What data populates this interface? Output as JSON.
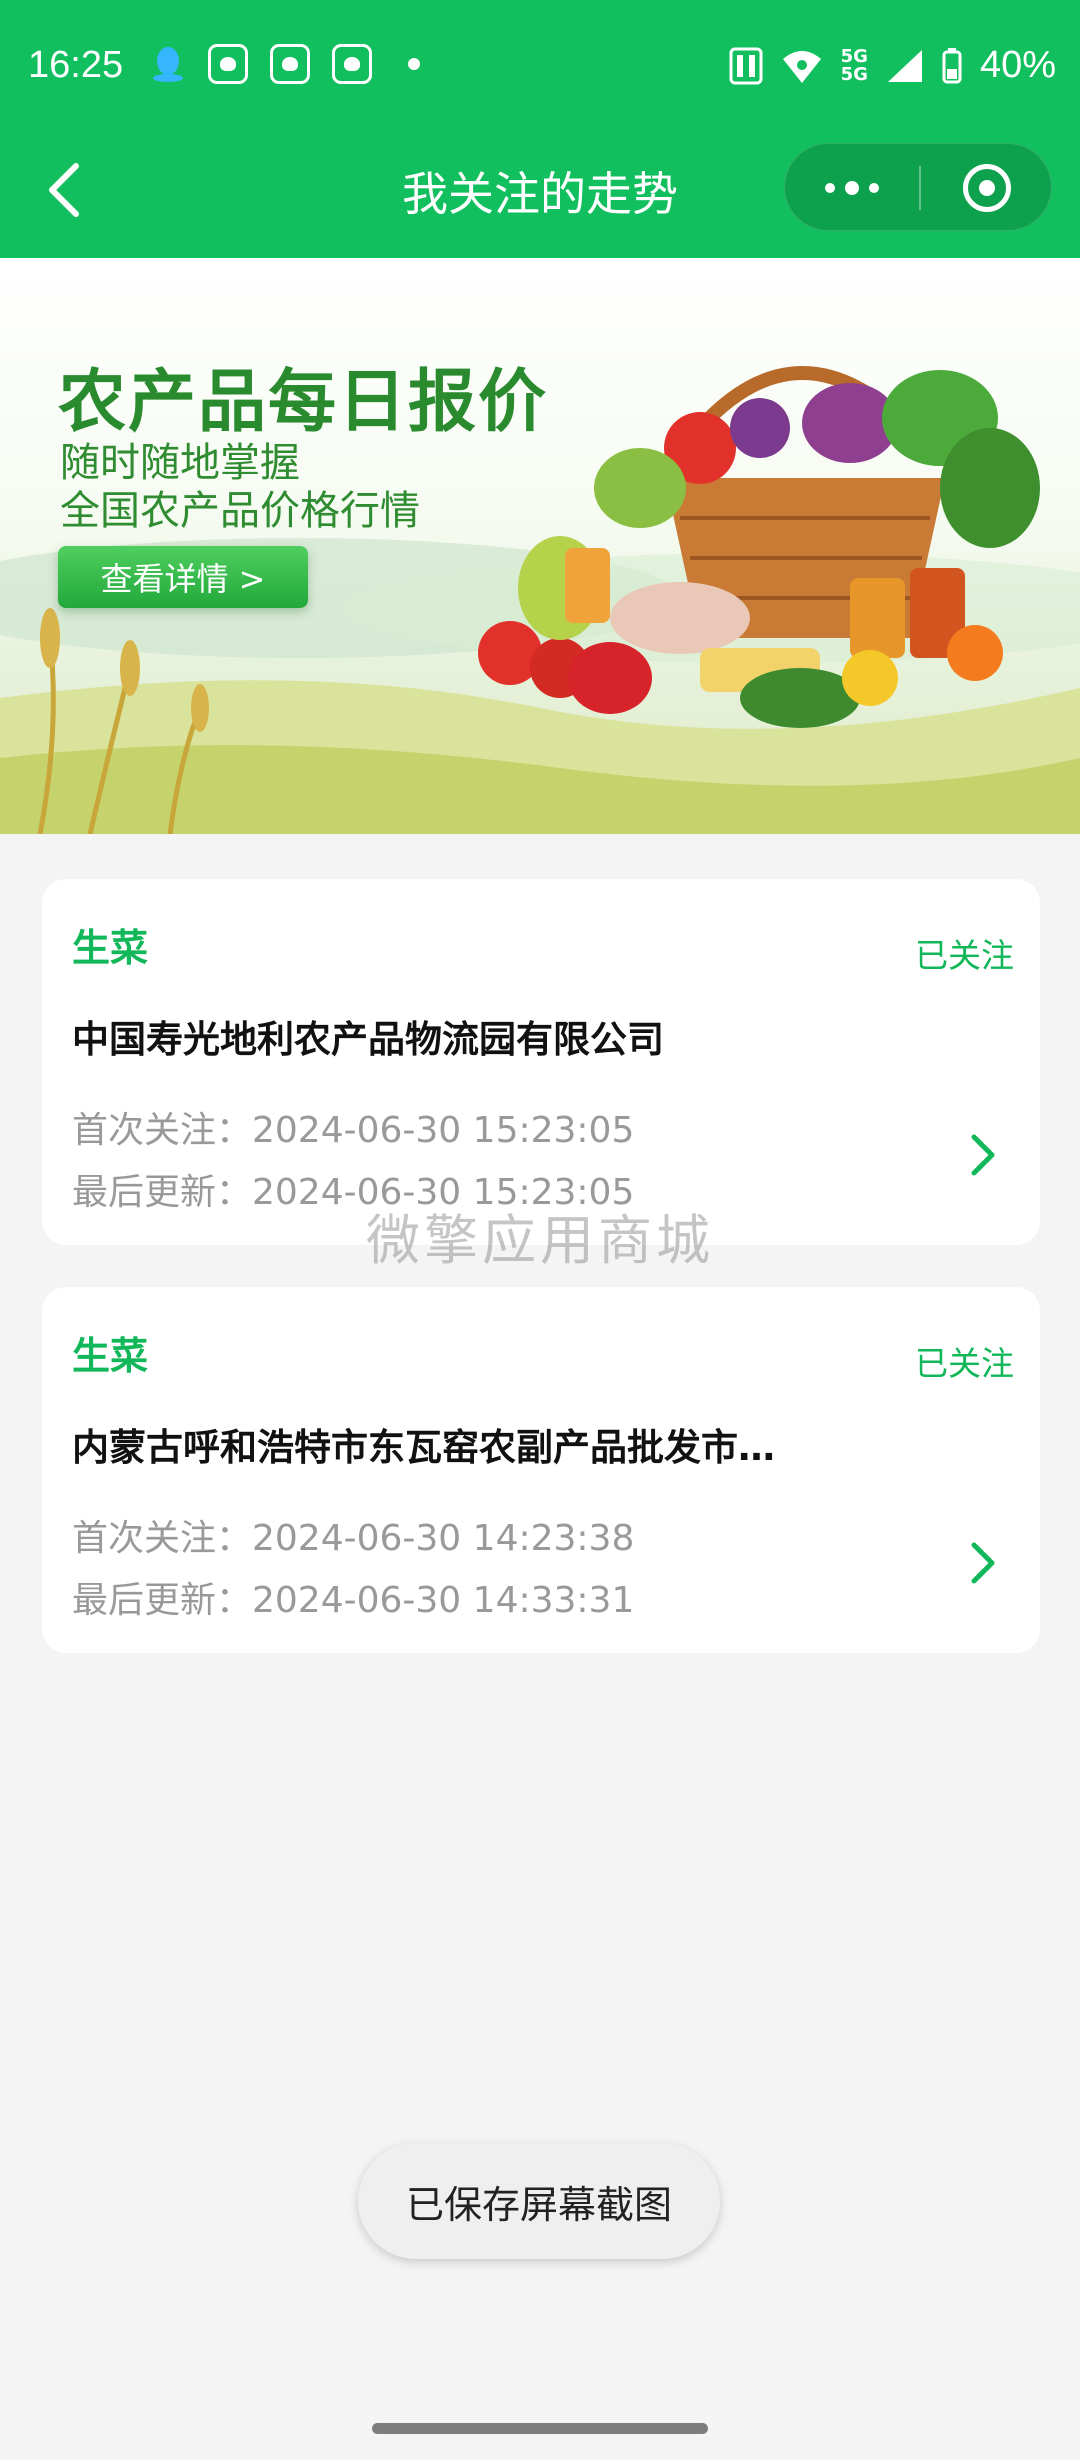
{
  "status_bar": {
    "time": "16:25",
    "battery": "40%",
    "network_top": "5G",
    "network_bottom": "5G"
  },
  "nav": {
    "title": "我关注的走势",
    "back_icon": "chevron-left-icon",
    "more_icon": "more-dots-icon",
    "close_icon": "target-circle-icon"
  },
  "banner": {
    "title": "农产品每日报价",
    "subtitle_line1": "随时随地掌握",
    "subtitle_line2": "全国农产品价格行情",
    "button_label": "查看详情 >"
  },
  "cards": [
    {
      "category": "生菜",
      "follow_status": "已关注",
      "market_name": "中国寿光地利农产品物流园有限公司",
      "first_follow": "首次关注：2024-06-30 15:23:05",
      "last_update": "最后更新：2024-06-30 15:23:05"
    },
    {
      "category": "生菜",
      "follow_status": "已关注",
      "market_name": "内蒙古呼和浩特市东瓦窑农副产品批发市…",
      "first_follow": "首次关注：2024-06-30 14:23:38",
      "last_update": "最后更新：2024-06-30 14:33:31"
    }
  ],
  "watermark": "微擎应用商城",
  "toast": "已保存屏幕截图",
  "colors": {
    "brand_green": "#12bf5e",
    "accent_green": "#12b75a",
    "page_bg": "#f4f4f4"
  }
}
